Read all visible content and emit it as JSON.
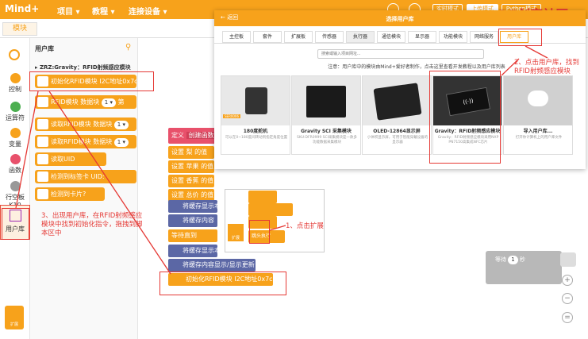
{
  "app": {
    "logo": "Mind+",
    "menus": [
      "项目 ▾",
      "教程 ▾",
      "连接设备 ▾"
    ],
    "modes": [
      "实时模式",
      "上传模式",
      "Python模式"
    ]
  },
  "watermark": "DF创客社区",
  "tabs": {
    "blocks": "模块"
  },
  "categories": [
    {
      "label": "控制",
      "color": "#f7a21b"
    },
    {
      "label": "运算符",
      "color": "#4caf50"
    },
    {
      "label": "变量",
      "color": "#f7a21b"
    },
    {
      "label": "函数",
      "color": "#e8516b"
    },
    {
      "label": "行空板K10",
      "color": "#999999"
    },
    {
      "label": "用户库",
      "color": "#9c27b0"
    }
  ],
  "ext_label": "扩展",
  "palette": {
    "title": "用户库",
    "group": "ZRZ:Gravity：RFID射频感应模块",
    "blocks": [
      "初始化RFID模块 I2C地址0x7c",
      "RFID模块 数据块",
      "读取RFID模块 数据块",
      "读取RFID模块 数据块",
      "读取UID",
      "检测到标签卡 UID:",
      "检测到卡片?"
    ],
    "pills": [
      "1 ▾",
      "第",
      "1 ▾",
      "1 ▾"
    ]
  },
  "script": {
    "define": "定义",
    "create": "创建函数",
    "rows": [
      "设置 梨 的值",
      "设置 苹果 的值",
      "设置 香蕉 的值",
      "设置 总价 的值",
      "将缓存显示本",
      "将缓存内容",
      "等待直到",
      "将缓存显示本",
      "将缓存内容显示/显示更新"
    ],
    "dragged": "初始化RFID模块 I2C地址0x7c",
    "wait": "等待",
    "wait_val": "1",
    "wait_unit": "秒"
  },
  "dialog": {
    "back": "← 返回",
    "title": "选择用户库",
    "tabs": [
      "主控板",
      "套件",
      "扩展板",
      "传感器",
      "执行器",
      "通信模块",
      "显示器",
      "功能模块",
      "网络服务",
      "用户库"
    ],
    "search_placeholder": "搜索或输入项目网址...",
    "note": "注意：用户库中的模块由Mind+爱好者制作，点击这里查看开发教程以及用户库列表",
    "cards": [
      {
        "title": "180度舵机",
        "desc": "可以在0~180度间转动到指定角度位置",
        "sku": "SER0006"
      },
      {
        "title": "Gravity SCI 采集模块",
        "desc": "SKU:DFR0999 SCI采集模块是一款多功能数据采集模块"
      },
      {
        "title": "OLED-12864显示屏",
        "desc": "小体积显示屏，可用于智能穿戴设备的显示器"
      },
      {
        "title": "Gravity：RFID射频感应模块",
        "desc": "Gravity：RFID射频感应模块采用NXP PN7150高集成NFC芯片"
      },
      {
        "title": "导入用户库...",
        "desc": "打开你计算机上的用户库文件"
      }
    ]
  },
  "annotations": {
    "a1": "1、点击扩展",
    "a2": "2、点击用户库，找到RFID射频感应模块",
    "a3": "3、出现用户库，在RFID射频感应模块中找到初始化指令，拖拽到脚本区中"
  },
  "mini": {
    "ext": "扩展",
    "pm": "跳头执行"
  }
}
